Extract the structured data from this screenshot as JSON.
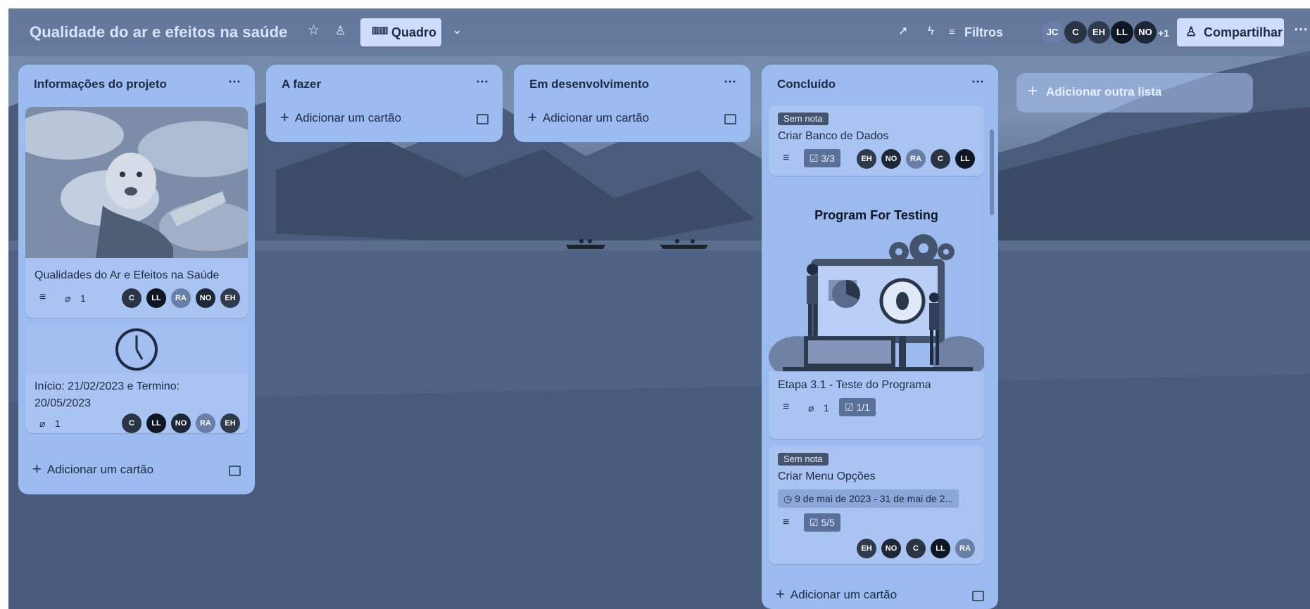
{
  "board": {
    "title": "Qualidade do ar e efeitos na saúde",
    "view_label": "Quadro",
    "filters_label": "Filtros",
    "share_label": "Compartilhar",
    "members": [
      {
        "initials": "JC",
        "color": "#6a7fa8"
      },
      {
        "initials": "C",
        "color": "#2b3445"
      },
      {
        "initials": "EH",
        "color": "#2f3a4d"
      },
      {
        "initials": "LL",
        "color": "#0f1724"
      },
      {
        "initials": "NO",
        "color": "#1e2738"
      }
    ],
    "extra_members": "+1"
  },
  "lists": [
    {
      "title": "Informações do projeto",
      "add_card_label": "Adicionar um cartão",
      "cards": [
        {
          "title": "Qualidades do Ar e Efeitos na Saúde",
          "attachments": "1",
          "members": [
            "C",
            "LL",
            "RA",
            "NO",
            "EH"
          ]
        },
        {
          "title": "Início: 21/02/2023 e Termino: 20/05/2023",
          "attachments": "1",
          "members": [
            "C",
            "LL",
            "NO",
            "RA",
            "EH"
          ]
        }
      ]
    },
    {
      "title": "A fazer",
      "add_card_label": "Adicionar um cartão"
    },
    {
      "title": "Em desenvolvimento",
      "add_card_label": "Adicionar um cartão"
    },
    {
      "title": "Concluído",
      "add_card_label": "Adicionar um cartão",
      "cards": [
        {
          "label": "Sem nota",
          "title": "Criar Banco de Dados",
          "checklist": "3/3",
          "members": [
            "EH",
            "NO",
            "RA",
            "C",
            "LL"
          ]
        },
        {
          "cover_title": "Program For Testing",
          "title": "Etapa 3.1 - Teste do Programa",
          "attachments": "1",
          "checklist": "1/1"
        },
        {
          "label": "Sem nota",
          "title": "Criar Menu Opções",
          "date": "9 de mai de 2023 - 31 de mai de 2...",
          "checklist": "5/5",
          "members": [
            "EH",
            "NO",
            "C",
            "LL",
            "RA"
          ]
        }
      ]
    }
  ],
  "add_list_label": "Adicionar outra lista",
  "colors": {
    "list_bg": "#9cbbf0",
    "card_bg": "#a9c4f3",
    "header_button_bg": "#cfdcfb",
    "text_dark": "#1d2b44"
  },
  "icons": [
    "star-icon",
    "workspace-visibility-icon",
    "board-view-icon",
    "chevron-down-icon",
    "power-ups-icon",
    "automation-icon",
    "filter-icon",
    "share-person-icon",
    "more-icon",
    "plus-icon",
    "template-icon",
    "description-icon",
    "attachment-icon",
    "checklist-icon",
    "clock-icon"
  ]
}
